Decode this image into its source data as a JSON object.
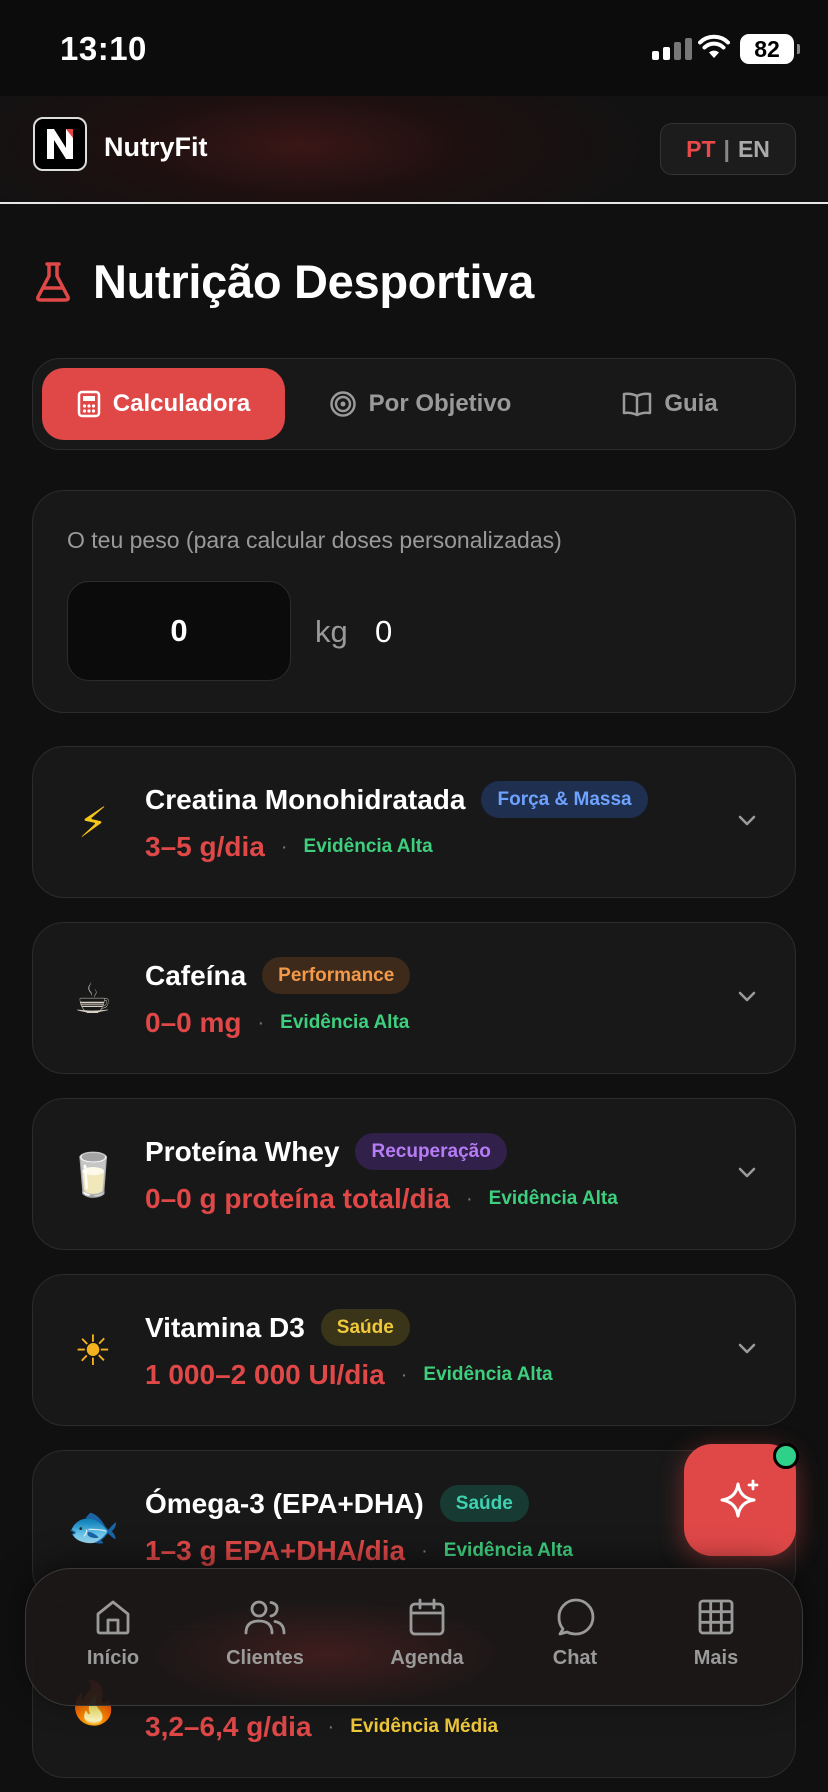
{
  "status_bar": {
    "time": "13:10",
    "battery": "82"
  },
  "header": {
    "app_name": "NutryFit",
    "lang_active": "PT",
    "lang_separator": "|",
    "lang_other": "EN"
  },
  "page": {
    "title": "Nutrição Desportiva"
  },
  "tabs": [
    {
      "label": "Calculadora",
      "icon": "calculator-icon",
      "active": true
    },
    {
      "label": "Por Objetivo",
      "icon": "target-icon",
      "active": false
    },
    {
      "label": "Guia",
      "icon": "book-icon",
      "active": false
    }
  ],
  "weight": {
    "label": "O teu peso (para calcular doses personalizadas)",
    "value": "0",
    "placeholder": "0",
    "unit": "kg",
    "computed": "0"
  },
  "supplements": [
    {
      "emoji": "⚡",
      "name": "Creatina Monohidratada",
      "badge": "Força & Massa",
      "badge_bg": "#1f2f4f",
      "badge_color": "#6ea2ff",
      "dose": "3–5 g/dia",
      "evidence": "Evidência Alta",
      "evidence_color": "#3ecf7e"
    },
    {
      "emoji": "☕",
      "name": "Cafeína",
      "badge": "Performance",
      "badge_bg": "#3d2a1a",
      "badge_color": "#f29a4a",
      "dose": "0–0 mg",
      "evidence": "Evidência Alta",
      "evidence_color": "#3ecf7e"
    },
    {
      "emoji": "🥛",
      "name": "Proteína Whey",
      "badge": "Recuperação",
      "badge_bg": "#30204a",
      "badge_color": "#b77cf5",
      "dose": "0–0 g proteína total/dia",
      "evidence": "Evidência Alta",
      "evidence_color": "#3ecf7e"
    },
    {
      "emoji": "☀",
      "name": "Vitamina D3",
      "badge": "Saúde",
      "badge_bg": "#3a3418",
      "badge_color": "#f0c93a",
      "dose": "1 000–2 000 UI/dia",
      "evidence": "Evidência Alta",
      "evidence_color": "#3ecf7e"
    },
    {
      "emoji": "🐟",
      "name": "Ómega-3 (EPA+DHA)",
      "badge": "Saúde",
      "badge_bg": "#173a32",
      "badge_color": "#3fd1b0",
      "dose": "1–3 g EPA+DHA/dia",
      "evidence": "Evidência Alta",
      "evidence_color": "#3ecf7e"
    },
    {
      "emoji": "🔥",
      "name": "",
      "badge": "",
      "badge_bg": "#3a3418",
      "badge_color": "#f0c93a",
      "dose": "3,2–6,4 g/dia",
      "evidence": "Evidência Média",
      "evidence_color": "#f0c93a"
    }
  ],
  "bottom_nav": [
    {
      "label": "Início",
      "icon": "home-icon"
    },
    {
      "label": "Clientes",
      "icon": "users-icon"
    },
    {
      "label": "Agenda",
      "icon": "calendar-icon"
    },
    {
      "label": "Chat",
      "icon": "chat-icon"
    },
    {
      "label": "Mais",
      "icon": "grid-icon"
    }
  ],
  "fab": {
    "icon": "sparkles-icon",
    "badge_color": "#2fd08a"
  },
  "colors": {
    "accent": "#e04848",
    "background": "#101010",
    "card": "#181818"
  }
}
